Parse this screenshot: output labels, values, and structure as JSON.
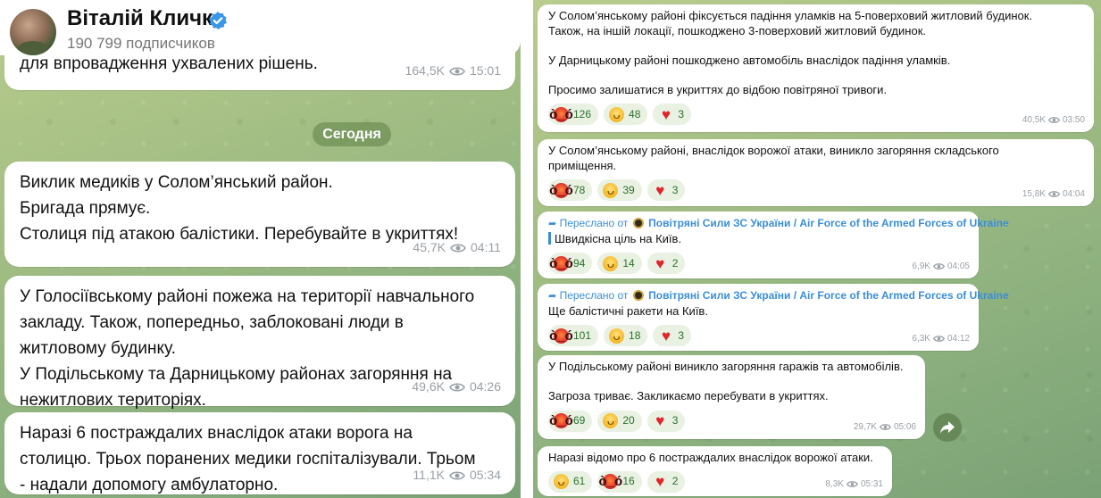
{
  "channel": {
    "name": "Віталій Кличко",
    "subscribers": "190 799 подписчиков"
  },
  "left_feed": {
    "date_separator": "Сегодня",
    "messages": [
      {
        "text": "Березень місто одноосі невідкл організації закл\nдля впровадження ухвалених рішень.",
        "views": "164,5K",
        "time": "15:01"
      },
      {
        "text": "Виклик медиків у Солом’янський район.\nБригада прямує.\nСтолиця під атакою балістики. Перебувайте в укриттях!",
        "views": "45,7K",
        "time": "04:11"
      },
      {
        "text": "У Голосіївському районі пожежа на території навчального\nзакладу. Також, попередньо, заблоковані люди в\nжитловому будинку.\nУ Подільському та Дарницькому районах загоряння на\nнежитлових територіях.",
        "views": "49,6K",
        "time": "04:26"
      },
      {
        "text": "Наразі 6 постраждалих внаслідок атаки ворога на\nстолицю. Трьох поранених медики госпіталізували. Трьом\n- надали допомогу амбулаторно.",
        "views": "11,1K",
        "time": "05:34"
      }
    ]
  },
  "right_feed": {
    "messages": [
      {
        "text": "У Солом’янському районі фіксується падіння уламків на 5-поверховий житловий будинок.\nТакож, на іншій локації, пошкоджено 3-поверховий житловий будинок.\n\nУ Дарницькому районі пошкоджено автомобіль внаслідок падіння уламків.\n\nПросимо залишатися в укриттях до відбою повітряної тривоги.",
        "reactions": [
          {
            "emoji": "angry",
            "count": "126"
          },
          {
            "emoji": "cry",
            "count": "48"
          },
          {
            "emoji": "heart",
            "count": "3"
          }
        ],
        "views": "40,5K",
        "time": "03:50"
      },
      {
        "text": "У Солом’янському районі, внаслідок ворожої атаки, виникло загоряння складського\nприміщення.",
        "reactions": [
          {
            "emoji": "angry",
            "count": "78"
          },
          {
            "emoji": "cry",
            "count": "39"
          },
          {
            "emoji": "heart",
            "count": "3"
          }
        ],
        "views": "15,8K",
        "time": "04:04"
      },
      {
        "forwarded_prefix": "Переслано от",
        "forwarded_from": "Повітряні Сили ЗС України / Air Force of the Armed Forces of Ukraine",
        "text": "Швидкісна ціль на Київ.",
        "reactions": [
          {
            "emoji": "angry",
            "count": "94"
          },
          {
            "emoji": "cry",
            "count": "14"
          },
          {
            "emoji": "heart",
            "count": "2"
          }
        ],
        "views": "6,9K",
        "time": "04:05"
      },
      {
        "forwarded_prefix": "Переслано от",
        "forwarded_from": "Повітряні Сили ЗС України / Air Force of the Armed Forces of Ukraine",
        "text": "Ще балістичні ракети на Київ.",
        "reactions": [
          {
            "emoji": "angry",
            "count": "101"
          },
          {
            "emoji": "cry",
            "count": "18"
          },
          {
            "emoji": "heart",
            "count": "3"
          }
        ],
        "views": "6,3K",
        "time": "04:12"
      },
      {
        "text": "У Подільському районі виникло загоряння гаражів та автомобілів.\n\nЗагроза триває. Закликаємо перебувати в укриттях.",
        "reactions": [
          {
            "emoji": "angry",
            "count": "69"
          },
          {
            "emoji": "cry",
            "count": "20"
          },
          {
            "emoji": "heart",
            "count": "3"
          }
        ],
        "views": "29,7K",
        "time": "05:06"
      },
      {
        "text": "Наразі відомо про 6 постраждалих внаслідок ворожої атаки.",
        "reactions": [
          {
            "emoji": "cry",
            "count": "61"
          },
          {
            "emoji": "angry",
            "count": "16"
          },
          {
            "emoji": "heart",
            "count": "2"
          }
        ],
        "views": "8,3K",
        "time": "05:31"
      }
    ]
  },
  "colors": {
    "accent": "#3b8ed6",
    "verified": "#3a97e8",
    "reaction_bg": "#e9f1e2",
    "meta": "#9aa0a6"
  },
  "icons": {
    "verified": "verified-badge-icon",
    "views": "eye-icon",
    "share": "share-arrow-icon",
    "forward": "forward-arrow-icon"
  }
}
